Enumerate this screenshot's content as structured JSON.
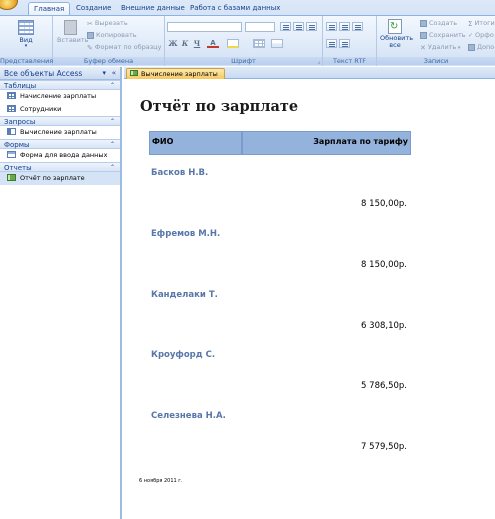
{
  "ribbon": {
    "tabs": [
      "Главная",
      "Создание",
      "Внешние данные",
      "Работа с базами данных"
    ],
    "active_tab": "Главная",
    "groups": {
      "views": {
        "label": "Представления",
        "view_button": "Вид"
      },
      "clipboard": {
        "label": "Буфер обмена",
        "paste": "Вставить",
        "cut": "Вырезать",
        "copy": "Копировать",
        "format_painter": "Формат по образцу"
      },
      "font": {
        "label": "Шрифт",
        "bold": "Ж",
        "italic": "К",
        "underline": "Ч"
      },
      "rich_text": {
        "label": "Текст RTF"
      },
      "records": {
        "label": "Записи",
        "refresh": "Обновить все",
        "create": "Создать",
        "save": "Сохранить",
        "delete": "Удалить",
        "totals": "Итоги",
        "spelling": "Орфо",
        "more": "Допо"
      }
    }
  },
  "nav_pane": {
    "header": "Все объекты Access",
    "groups": [
      {
        "title": "Таблицы",
        "items": [
          "Начисление зарплаты",
          "Сотрудники"
        ]
      },
      {
        "title": "Запросы",
        "items": [
          "Вычисление зарплаты"
        ]
      },
      {
        "title": "Формы",
        "items": [
          "Форма для ввода данных"
        ]
      },
      {
        "title": "Отчеты",
        "items": [
          "Отчёт по зарплате"
        ]
      }
    ],
    "selected_item": "Отчёт по зарплате"
  },
  "document": {
    "tab_label": "Вычисление зарплаты",
    "report": {
      "title": "Отчёт по зарплате",
      "columns": [
        "ФИО",
        "Зарплата по тарифу"
      ],
      "records": [
        {
          "name": "Басков Н.В.",
          "salary": "8 150,00р."
        },
        {
          "name": "Ефремов М.Н.",
          "salary": "8 150,00р."
        },
        {
          "name": "Канделаки Т.",
          "salary": "6 308,10р."
        },
        {
          "name": "Кроуфорд С.",
          "salary": "5 786,50р."
        },
        {
          "name": "Селезнева Н.А.",
          "salary": "7 579,50р."
        }
      ],
      "date": "6 ноября 2011 г."
    }
  },
  "colors": {
    "ribbon_bg": "#c2d7f1",
    "header_fill": "#93b3dd",
    "name_text": "#5876a8",
    "doc_tab": "#f7c860"
  }
}
